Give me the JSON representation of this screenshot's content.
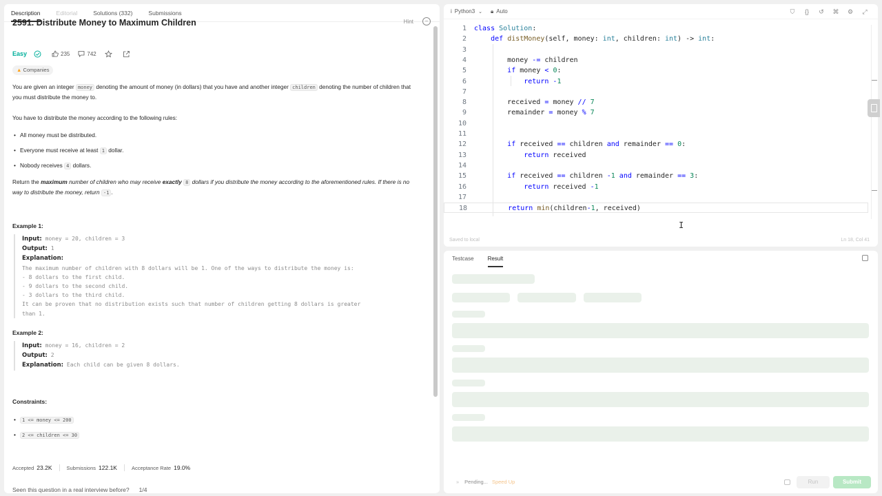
{
  "left_tabs": [
    "Description",
    "Editorial",
    "Solutions (332)",
    "Submissions"
  ],
  "problem": {
    "title": "2591. Distribute Money to Maximum Children",
    "hint_label": "Hint",
    "difficulty": "Easy",
    "likes": "235",
    "comments": "742",
    "companies_label": "Companies",
    "desc_p1_a": "You are given an integer ",
    "desc_p1_code1": "money",
    "desc_p1_b": " denoting the amount of money (in dollars) that you have and another integer ",
    "desc_p1_code2": "children",
    "desc_p1_c": " denoting the number of children that you must distribute the money to.",
    "desc_p2": "You have to distribute the money according to the following rules:",
    "rule1": "All money must be distributed.",
    "rule2_a": "Everyone must receive at least ",
    "rule2_code": "1",
    "rule2_b": " dollar.",
    "rule3_a": "Nobody receives ",
    "rule3_code": "4",
    "rule3_b": " dollars.",
    "ret_a": "Return the ",
    "ret_b": "maximum",
    "ret_c": " number of children who may receive ",
    "ret_d": "exactly",
    "ret_code1": "8",
    "ret_e": " dollars if you distribute the money according to the aforementioned rules. If there is no way to distribute the money, return ",
    "ret_code2": "-1",
    "ret_f": "."
  },
  "example1": {
    "title": "Example 1:",
    "input_label": "Input:",
    "input": "money = 20, children = 3",
    "output_label": "Output:",
    "output": "1",
    "explanation_label": "Explanation:",
    "lines": [
      "The maximum number of children with 8 dollars will be 1. One of the ways to distribute the money is:",
      "- 8 dollars to the first child.",
      "- 9 dollars to the second child.",
      "- 3 dollars to the third child.",
      "It can be proven that no distribution exists such that number of children getting 8 dollars is greater",
      "than 1."
    ]
  },
  "example2": {
    "title": "Example 2:",
    "input_label": "Input:",
    "input": "money = 16, children = 2",
    "output_label": "Output:",
    "output": "2",
    "explanation_label": "Explanation:",
    "explanation": "Each child can be given 8 dollars."
  },
  "constraints": {
    "title": "Constraints:",
    "c1": "1 <= money <= 200",
    "c2": "2 <= children <= 30"
  },
  "stats": {
    "accepted_label": "Accepted",
    "accepted": "23.2K",
    "submissions_label": "Submissions",
    "submissions": "122.1K",
    "rate_label": "Acceptance Rate",
    "rate": "19.0%"
  },
  "seen": {
    "question": "Seen this question in a real interview before?",
    "page": "1/4"
  },
  "editor": {
    "language": "Python3",
    "mode": "Auto",
    "saved": "Saved to local",
    "cursor": "Ln 18, Col 41",
    "line_numbers": [
      "1",
      "2",
      "3",
      "4",
      "5",
      "6",
      "7",
      "8",
      "9",
      "10",
      "11",
      "12",
      "13",
      "14",
      "15",
      "16",
      "17",
      "18"
    ]
  },
  "result_tabs": [
    "Testcase",
    "Result"
  ],
  "result": {
    "pending": "Pending...",
    "speed": "Speed Up",
    "run": "Run",
    "submit": "Submit"
  },
  "colors": {
    "easy": "#00af9b",
    "submit": "#b8e8c4",
    "keyword": "#0000ff"
  }
}
